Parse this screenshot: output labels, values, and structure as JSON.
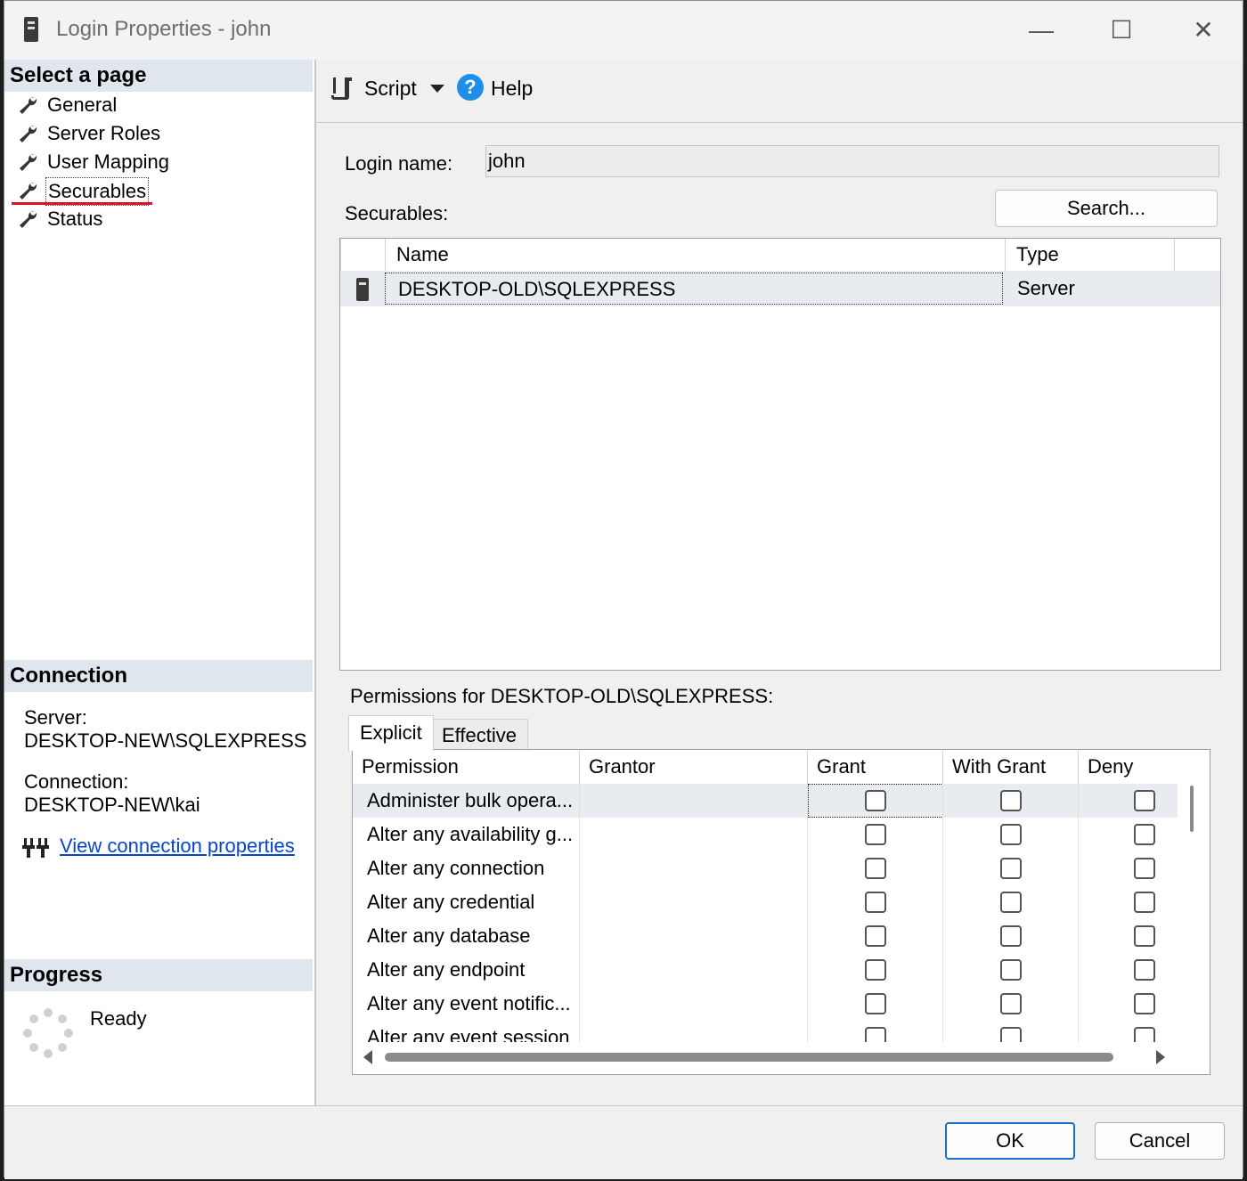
{
  "window": {
    "title": "Login Properties - john"
  },
  "titlebar_buttons": {
    "minimize": "—",
    "maximize": "☐",
    "close": "✕"
  },
  "left": {
    "select_page_header": "Select a page",
    "pages": [
      "General",
      "Server Roles",
      "User Mapping",
      "Securables",
      "Status"
    ],
    "active_page": "Securables",
    "connection_header": "Connection",
    "server_label": "Server:",
    "server_value": "DESKTOP-NEW\\SQLEXPRESS",
    "connection_label": "Connection:",
    "connection_value": "DESKTOP-NEW\\kai",
    "view_connection_link": "View connection properties",
    "progress_header": "Progress",
    "progress_status": "Ready"
  },
  "toolbar": {
    "script_label": "Script",
    "help_label": "Help"
  },
  "form": {
    "login_name_label": "Login name:",
    "login_name_value": "john",
    "securables_label": "Securables:",
    "search_button": "Search..."
  },
  "securables_grid": {
    "columns": [
      "Name",
      "Type"
    ],
    "rows": [
      {
        "name": "DESKTOP-OLD\\SQLEXPRESS",
        "type": "Server"
      }
    ]
  },
  "permissions": {
    "title": "Permissions for DESKTOP-OLD\\SQLEXPRESS:",
    "tabs": [
      "Explicit",
      "Effective"
    ],
    "active_tab": "Explicit",
    "columns": [
      "Permission",
      "Grantor",
      "Grant",
      "With Grant",
      "Deny"
    ],
    "rows": [
      {
        "permission": "Administer bulk opera...",
        "grantor": "",
        "grant": false,
        "with_grant": false,
        "deny": false
      },
      {
        "permission": "Alter any availability g...",
        "grantor": "",
        "grant": false,
        "with_grant": false,
        "deny": false
      },
      {
        "permission": "Alter any connection",
        "grantor": "",
        "grant": false,
        "with_grant": false,
        "deny": false
      },
      {
        "permission": "Alter any credential",
        "grantor": "",
        "grant": false,
        "with_grant": false,
        "deny": false
      },
      {
        "permission": "Alter any database",
        "grantor": "",
        "grant": false,
        "with_grant": false,
        "deny": false
      },
      {
        "permission": "Alter any endpoint",
        "grantor": "",
        "grant": false,
        "with_grant": false,
        "deny": false
      },
      {
        "permission": "Alter any event notific...",
        "grantor": "",
        "grant": false,
        "with_grant": false,
        "deny": false
      },
      {
        "permission": "Alter any event session",
        "grantor": "",
        "grant": false,
        "with_grant": false,
        "deny": false
      }
    ]
  },
  "footer": {
    "ok_button": "OK",
    "cancel_button": "Cancel"
  },
  "colors": {
    "accent": "#1e6fc8",
    "link": "#0645ce",
    "active_underline": "#e0102a",
    "section_header_bg": "#dfe6ee"
  }
}
